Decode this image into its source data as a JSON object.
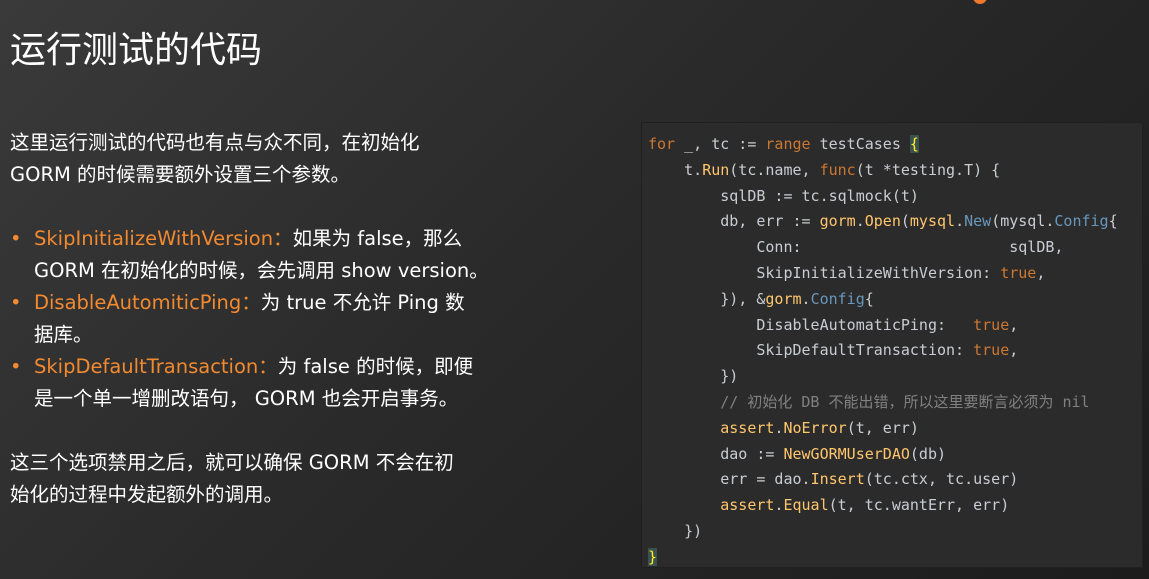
{
  "slide": {
    "title": "运行测试的代码"
  },
  "intro": {
    "lines": [
      "这里运行测试的代码也有点与众不同，在初始化",
      "GORM 的时候需要额外设置三个参数。"
    ]
  },
  "bullets": [
    {
      "key": "SkipInitializeWithVersion：",
      "rest_line1": "如果为 false，那么",
      "line2": "GORM 在初始化的时候，会先调用 show version。"
    },
    {
      "key": "DisableAutomiticPing：",
      "rest_line1": "为 true 不允许 Ping 数",
      "line2": "据库。"
    },
    {
      "key": "SkipDefaultTransaction：",
      "rest_line1": "为 false 的时候，即便",
      "line2": "是一个单一增删改语句， GORM 也会开启事务。"
    }
  ],
  "conclusion": {
    "lines": [
      "这三个选项禁用之后，就可以确保 GORM 不会在初",
      "始化的过程中发起额外的调用。"
    ]
  },
  "code": {
    "lines": [
      [
        [
          "kw",
          "for"
        ],
        [
          "ident",
          " _, tc := "
        ],
        [
          "kw",
          "range"
        ],
        [
          "ident",
          " testCases "
        ],
        [
          "brace",
          "{"
        ]
      ],
      [
        [
          "ident",
          "    t."
        ],
        [
          "fn",
          "Run"
        ],
        [
          "ident",
          "(tc.name, "
        ],
        [
          "kw",
          "func"
        ],
        [
          "ident",
          "(t *testing.T) {"
        ]
      ],
      [
        [
          "ident",
          "        sqlDB := tc.sqlmock(t)"
        ]
      ],
      [
        [
          "ident",
          "        db, err := "
        ],
        [
          "fn",
          "gorm"
        ],
        [
          "ident",
          "."
        ],
        [
          "fn",
          "Open"
        ],
        [
          "ident",
          "("
        ],
        [
          "fn",
          "mysql"
        ],
        [
          "ident",
          "."
        ],
        [
          "type",
          "New"
        ],
        [
          "ident",
          "(mysql."
        ],
        [
          "type",
          "Config"
        ],
        [
          "ident",
          "{"
        ]
      ],
      [
        [
          "ident",
          "            Conn:                       sqlDB,"
        ]
      ],
      [
        [
          "ident",
          "            SkipInitializeWithVersion: "
        ],
        [
          "kw",
          "true"
        ],
        [
          "ident",
          ","
        ]
      ],
      [
        [
          "ident",
          "        }), &"
        ],
        [
          "fn",
          "gorm"
        ],
        [
          "ident",
          "."
        ],
        [
          "type",
          "Config"
        ],
        [
          "ident",
          "{"
        ]
      ],
      [
        [
          "ident",
          "            DisableAutomaticPing:   "
        ],
        [
          "kw",
          "true"
        ],
        [
          "ident",
          ","
        ]
      ],
      [
        [
          "ident",
          "            SkipDefaultTransaction: "
        ],
        [
          "kw",
          "true"
        ],
        [
          "ident",
          ","
        ]
      ],
      [
        [
          "ident",
          "        })"
        ]
      ],
      [
        [
          "comment",
          "        // 初始化 DB 不能出错，所以这里要断言必须为 nil"
        ]
      ],
      [
        [
          "ident",
          "        "
        ],
        [
          "fn",
          "assert"
        ],
        [
          "ident",
          "."
        ],
        [
          "fn",
          "NoError"
        ],
        [
          "ident",
          "(t, err)"
        ]
      ],
      [
        [
          "ident",
          "        dao := "
        ],
        [
          "fn",
          "NewGORMUserDAO"
        ],
        [
          "ident",
          "(db)"
        ]
      ],
      [
        [
          "ident",
          "        err = dao."
        ],
        [
          "fn",
          "Insert"
        ],
        [
          "ident",
          "(tc.ctx, tc.user)"
        ]
      ],
      [
        [
          "ident",
          "        "
        ],
        [
          "fn",
          "assert"
        ],
        [
          "ident",
          "."
        ],
        [
          "fn",
          "Equal"
        ],
        [
          "ident",
          "(t, tc.wantErr, err)"
        ]
      ],
      [
        [
          "ident",
          "    })"
        ]
      ],
      [
        [
          "brace",
          "}"
        ]
      ]
    ]
  }
}
